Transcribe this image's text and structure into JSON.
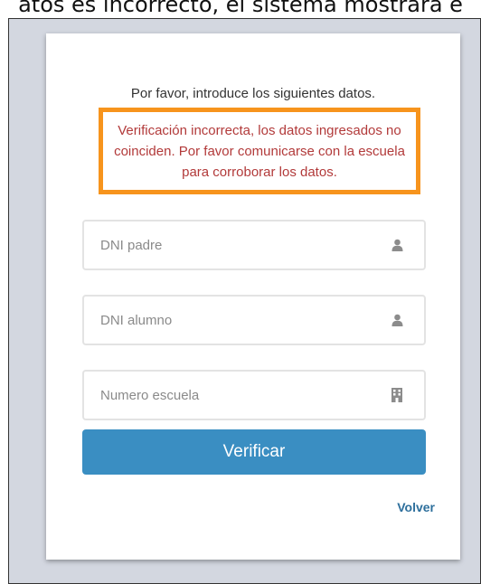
{
  "caption": "atos es incorrecto, el sistema mostrará e",
  "form": {
    "intro": "Por favor, introduce los siguientes datos.",
    "error_message": "Verificación incorrecta, los datos ingresados no coinciden. Por favor comunicarse con la escuela para corroborar los datos.",
    "error_border_color": "#f7941d",
    "fields": [
      {
        "placeholder": "DNI padre",
        "value": "",
        "icon": "user-icon"
      },
      {
        "placeholder": "DNI alumno",
        "value": "",
        "icon": "user-icon"
      },
      {
        "placeholder": "Numero escuela",
        "value": "",
        "icon": "building-icon"
      }
    ],
    "submit_label": "Verificar",
    "submit_color": "#3a8ec2",
    "back_link": "Volver"
  }
}
